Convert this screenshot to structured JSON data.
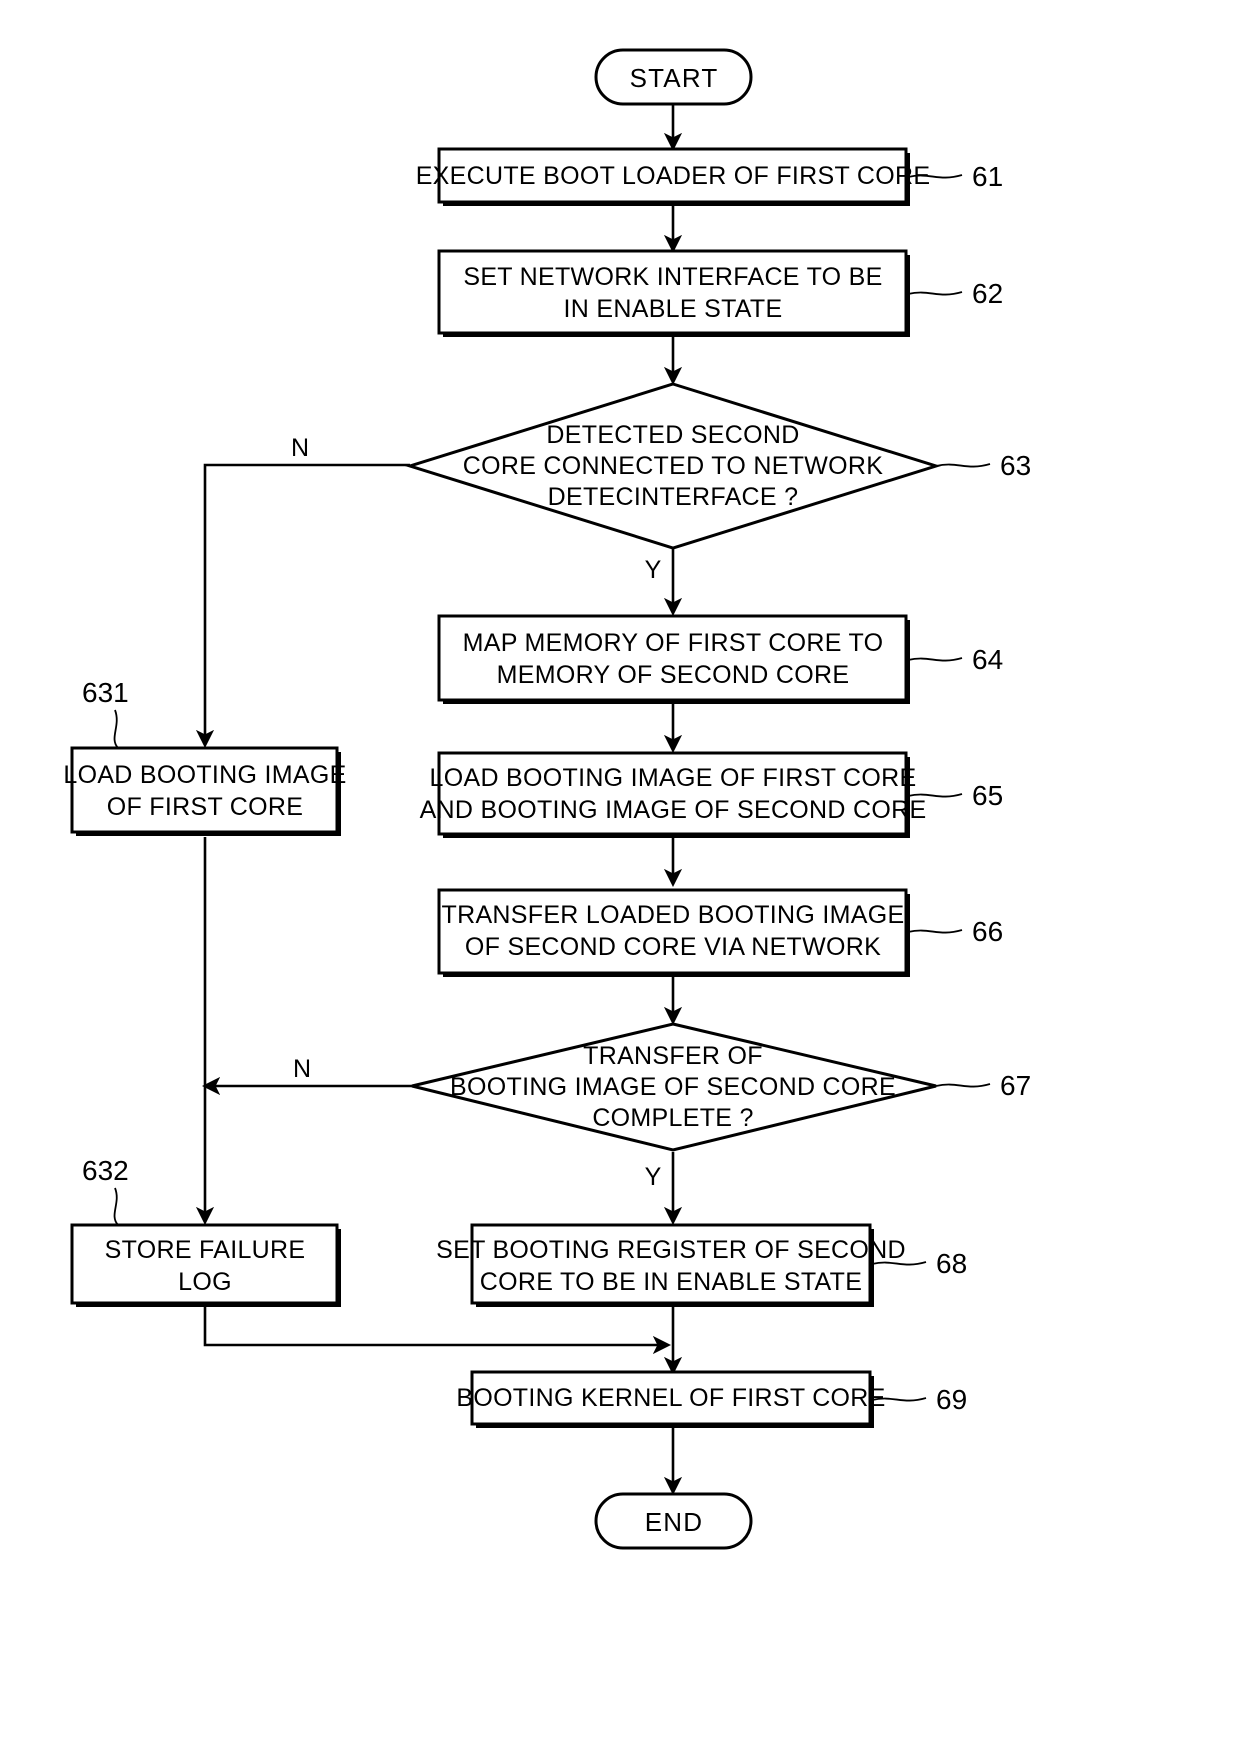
{
  "diagram": {
    "type": "flowchart",
    "title": "Boot sequence flowchart for first core and second core",
    "terminators": {
      "start": "START",
      "end": "END"
    },
    "branch_labels": {
      "yes": "Y",
      "no": "N"
    },
    "nodes": [
      {
        "id": "start",
        "shape": "terminator",
        "ref": "",
        "lines": [
          "START"
        ]
      },
      {
        "id": "n61",
        "shape": "process",
        "ref": "61",
        "lines": [
          "EXECUTE BOOT LOADER OF FIRST CORE"
        ]
      },
      {
        "id": "n62",
        "shape": "process",
        "ref": "62",
        "lines": [
          "SET NETWORK INTERFACE TO BE",
          "IN ENABLE STATE"
        ]
      },
      {
        "id": "n63",
        "shape": "decision",
        "ref": "63",
        "lines": [
          "DETECTED SECOND",
          "CORE CONNECTED TO NETWORK",
          "DETECINTERFACE ?"
        ]
      },
      {
        "id": "n631",
        "shape": "process",
        "ref": "631",
        "lines": [
          "LOAD BOOTING IMAGE",
          "OF FIRST CORE"
        ]
      },
      {
        "id": "n64",
        "shape": "process",
        "ref": "64",
        "lines": [
          "MAP MEMORY OF FIRST CORE TO",
          "MEMORY OF SECOND CORE"
        ]
      },
      {
        "id": "n65",
        "shape": "process",
        "ref": "65",
        "lines": [
          "LOAD BOOTING IMAGE OF FIRST CORE",
          "AND BOOTING IMAGE OF SECOND CORE"
        ]
      },
      {
        "id": "n66",
        "shape": "process",
        "ref": "66",
        "lines": [
          "TRANSFER LOADED BOOTING IMAGE",
          "OF SECOND CORE VIA NETWORK"
        ]
      },
      {
        "id": "n67",
        "shape": "decision",
        "ref": "67",
        "lines": [
          "TRANSFER OF",
          "BOOTING IMAGE OF SECOND CORE",
          "COMPLETE ?"
        ]
      },
      {
        "id": "n632",
        "shape": "process",
        "ref": "632",
        "lines": [
          "STORE FAILURE",
          "LOG"
        ]
      },
      {
        "id": "n68",
        "shape": "process",
        "ref": "68",
        "lines": [
          "SET BOOTING REGISTER OF SECOND",
          "CORE TO BE IN ENABLE STATE"
        ]
      },
      {
        "id": "n69",
        "shape": "process",
        "ref": "69",
        "lines": [
          "BOOTING KERNEL OF FIRST CORE"
        ]
      },
      {
        "id": "end",
        "shape": "terminator",
        "ref": "",
        "lines": [
          "END"
        ]
      }
    ],
    "edges": [
      {
        "from": "start",
        "to": "n61",
        "label": ""
      },
      {
        "from": "n61",
        "to": "n62",
        "label": ""
      },
      {
        "from": "n62",
        "to": "n63",
        "label": ""
      },
      {
        "from": "n63",
        "to": "n631",
        "label": "N"
      },
      {
        "from": "n63",
        "to": "n64",
        "label": "Y"
      },
      {
        "from": "n64",
        "to": "n65",
        "label": ""
      },
      {
        "from": "n65",
        "to": "n66",
        "label": ""
      },
      {
        "from": "n66",
        "to": "n67",
        "label": ""
      },
      {
        "from": "n67",
        "to": "n632",
        "label": "N"
      },
      {
        "from": "n67",
        "to": "n68",
        "label": "Y"
      },
      {
        "from": "n631",
        "to": "n632",
        "label": ""
      },
      {
        "from": "n632",
        "to": "n69",
        "label": ""
      },
      {
        "from": "n68",
        "to": "n69",
        "label": ""
      },
      {
        "from": "n69",
        "to": "end",
        "label": ""
      }
    ],
    "colors": {
      "stroke": "#000000",
      "fill": "#ffffff",
      "text": "#000000"
    }
  }
}
